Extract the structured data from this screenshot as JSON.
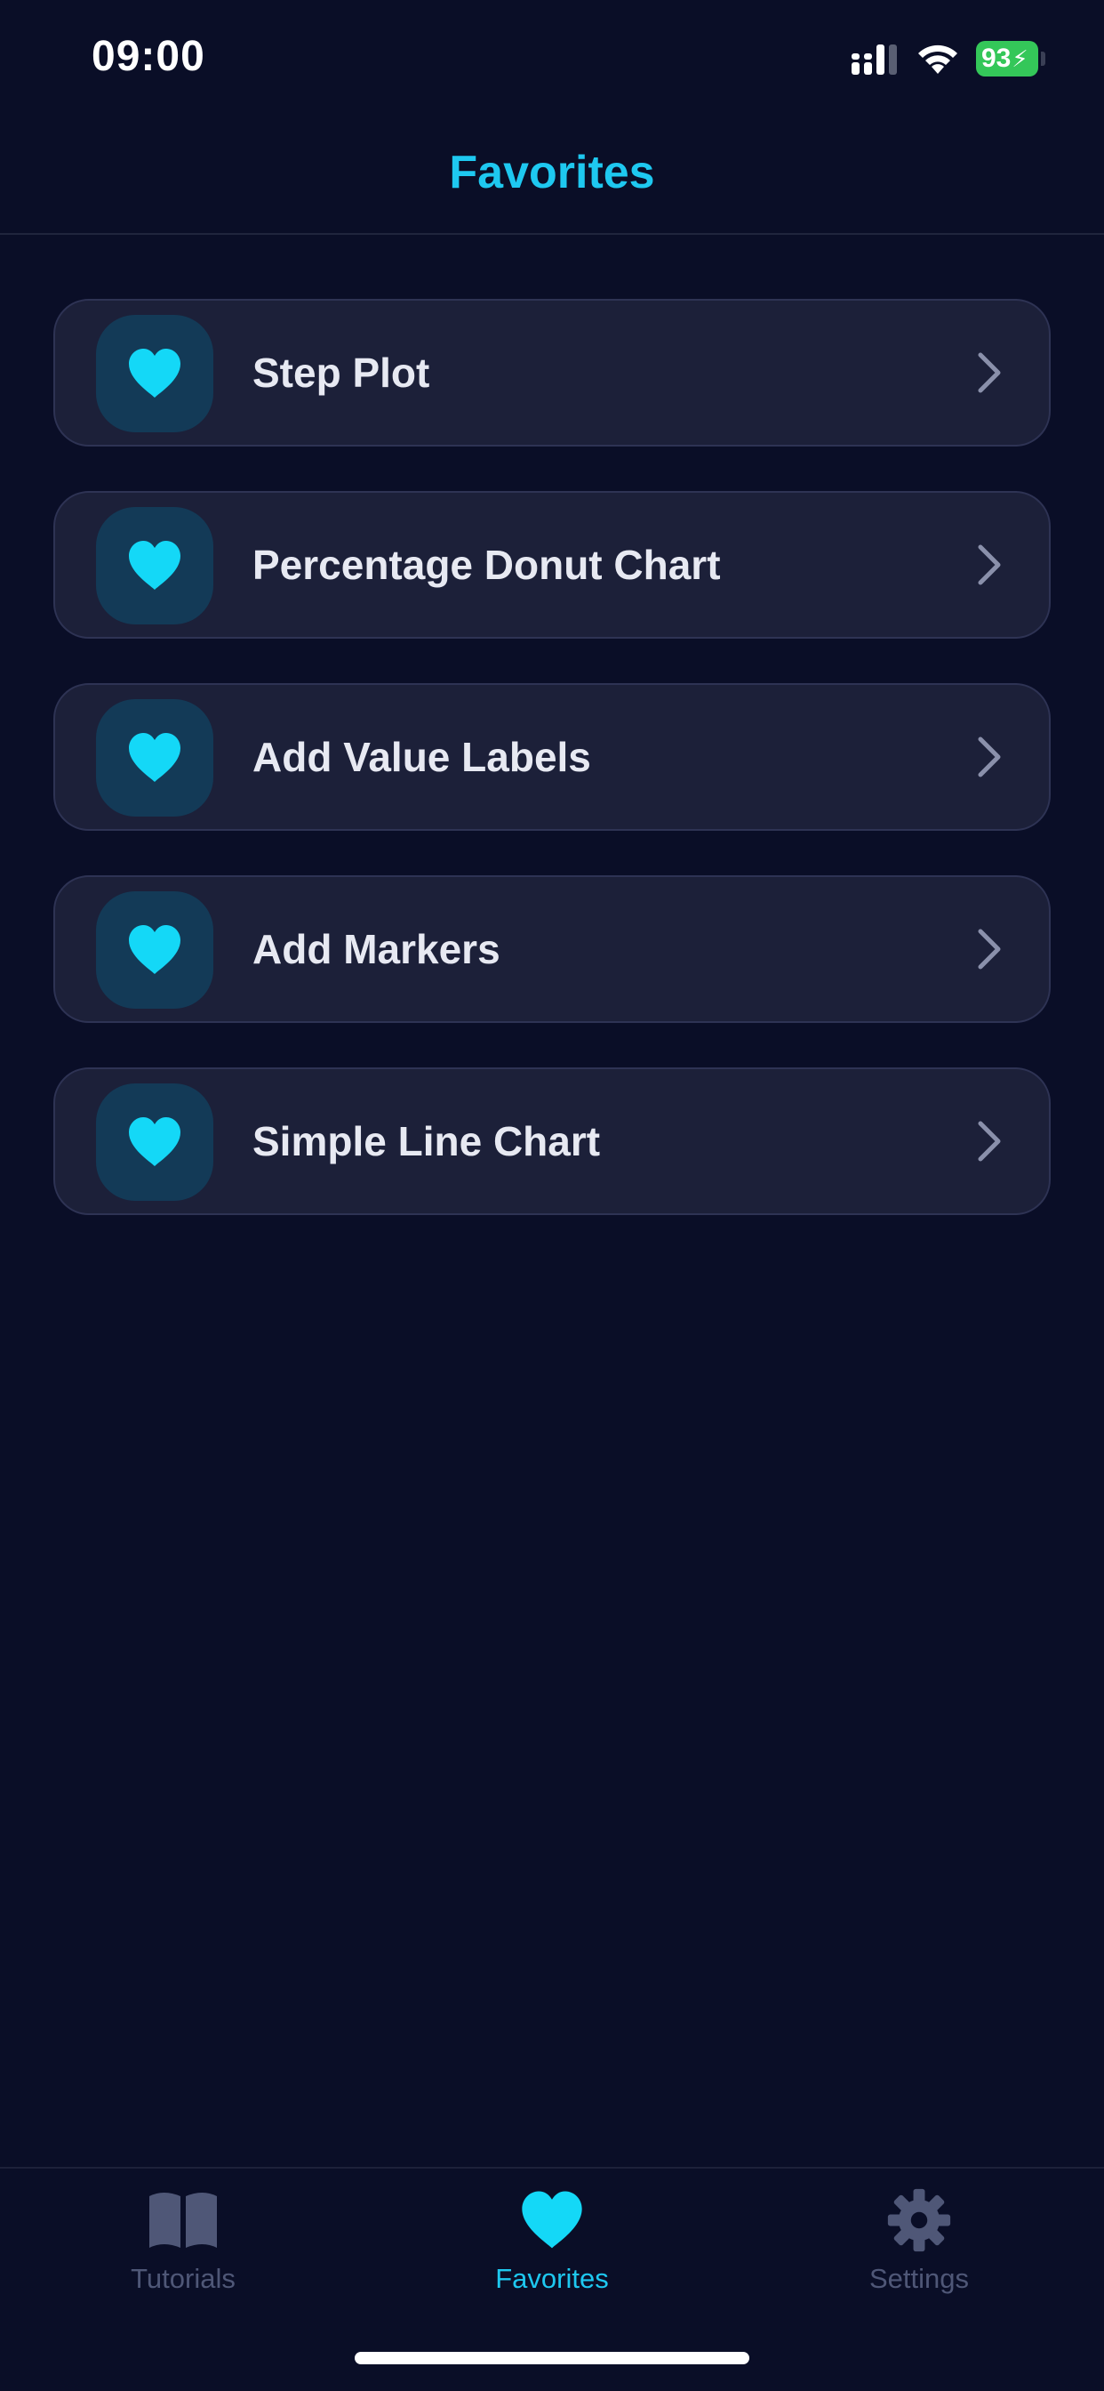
{
  "status_bar": {
    "time": "09:00",
    "battery": "93"
  },
  "header": {
    "title": "Favorites"
  },
  "favorites": {
    "items": [
      {
        "label": "Step Plot"
      },
      {
        "label": "Percentage Donut Chart"
      },
      {
        "label": "Add Value Labels"
      },
      {
        "label": "Add Markers"
      },
      {
        "label": "Simple Line Chart"
      }
    ],
    "item_icon": "heart-icon",
    "trailing_icon": "chevron-right-icon"
  },
  "tab_bar": {
    "tabs": [
      {
        "label": "Tutorials",
        "icon": "book-icon",
        "active": false
      },
      {
        "label": "Favorites",
        "icon": "heart-icon",
        "active": true
      },
      {
        "label": "Settings",
        "icon": "gear-icon",
        "active": false
      }
    ]
  },
  "colors": {
    "background": "#0a0e27",
    "accent": "#1ec8f0",
    "card": "#1c2039",
    "muted": "#4f5777",
    "battery": "#34c759"
  }
}
